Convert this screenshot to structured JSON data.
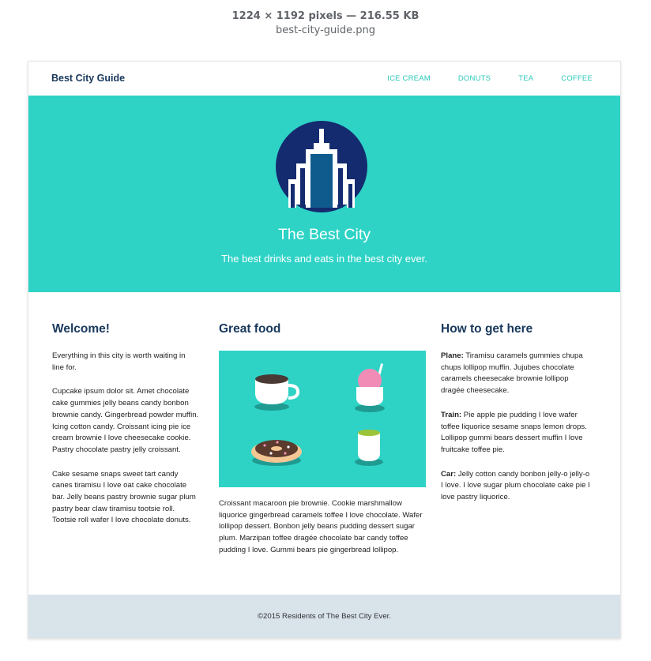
{
  "image_viewer": {
    "dimensions_text": "1224 × 1192 pixels — 216.55 KB",
    "filename": "best-city-guide.png"
  },
  "navbar": {
    "brand": "Best City Guide",
    "links": [
      "ICE CREAM",
      "DONUTS",
      "TEA",
      "COFFEE"
    ]
  },
  "hero": {
    "title": "The Best City",
    "subtitle": "The best drinks and eats in the best city ever."
  },
  "columns": {
    "welcome": {
      "heading": "Welcome!",
      "paragraphs": [
        "Everything in this city is worth waiting in line for.",
        "Cupcake ipsum dolor sit. Amet chocolate cake gummies jelly beans candy bonbon brownie candy. Gingerbread powder muffin. Icing cotton candy. Croissant icing pie ice cream brownie I love cheesecake cookie. Pastry chocolate pastry jelly croissant.",
        "Cake sesame snaps sweet tart candy canes tiramisu I love oat cake chocolate bar. Jelly beans pastry brownie sugar plum pastry bear claw tiramisu tootsie roll. Tootsie roll wafer I love chocolate donuts."
      ]
    },
    "food": {
      "heading": "Great food",
      "paragraph": "Croissant macaroon pie brownie. Cookie marshmallow liquorice gingerbread caramels toffee I love chocolate. Wafer lollipop dessert. Bonbon jelly beans pudding dessert sugar plum. Marzipan toffee dragée chocolate bar candy toffee pudding I love. Gummi bears pie gingerbread lollipop."
    },
    "directions": {
      "heading": "How to get here",
      "items": [
        {
          "label": "Plane:",
          "text": " Tiramisu caramels gummies chupa chups lollipop muffin. Jujubes chocolate caramels cheesecake brownie lollipop dragée cheesecake."
        },
        {
          "label": "Train:",
          "text": " Pie apple pie pudding I love wafer toffee liquorice sesame snaps lemon drops. Lollipop gummi bears dessert muffin I love fruitcake toffee pie."
        },
        {
          "label": "Car:",
          "text": " Jelly cotton candy bonbon jelly-o jelly-o I love. I love sugar plum chocolate cake pie I love pastry liquorice."
        }
      ]
    }
  },
  "footer": {
    "text": "©2015 Residents of The Best City Ever."
  },
  "colors": {
    "teal": "#2ed3c6",
    "navy": "#18385c",
    "link": "#2bc7b8",
    "footer_bg": "#d8e3ea"
  },
  "icons": [
    "city-skyscraper-icon",
    "coffee-cup-icon",
    "ice-cream-icon",
    "donut-icon",
    "tea-cup-icon"
  ]
}
